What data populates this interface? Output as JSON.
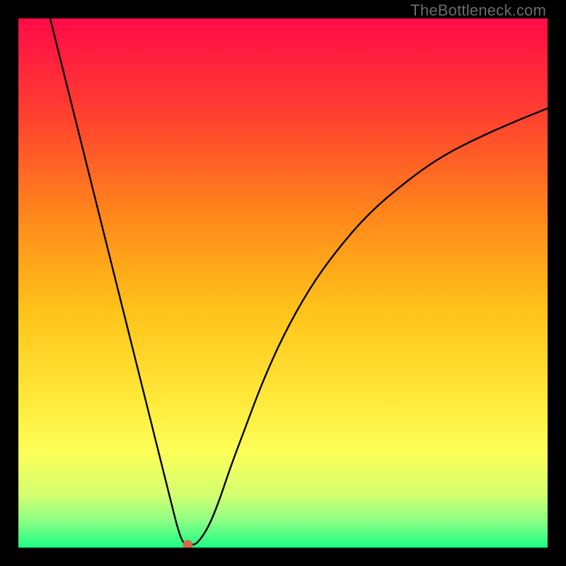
{
  "watermark": "TheBottleneck.com",
  "chart_data": {
    "type": "line",
    "title": "",
    "xlabel": "",
    "ylabel": "",
    "xlim": [
      0,
      100
    ],
    "ylim": [
      0,
      100
    ],
    "grid": false,
    "legend": false,
    "gradient_stops": [
      {
        "offset": 0.0,
        "color": "#ff0b47"
      },
      {
        "offset": 0.18,
        "color": "#ff3f30"
      },
      {
        "offset": 0.38,
        "color": "#ff8a1a"
      },
      {
        "offset": 0.55,
        "color": "#ffc21a"
      },
      {
        "offset": 0.72,
        "color": "#ffe93a"
      },
      {
        "offset": 0.82,
        "color": "#fcff58"
      },
      {
        "offset": 0.9,
        "color": "#d4ff70"
      },
      {
        "offset": 0.95,
        "color": "#8aff84"
      },
      {
        "offset": 1.0,
        "color": "#1bff86"
      }
    ],
    "series": [
      {
        "name": "bottleneck-curve",
        "x": [
          6,
          8,
          10,
          12,
          14,
          16,
          18,
          20,
          22,
          24,
          26,
          28,
          29,
          30,
          31,
          32,
          33,
          34,
          36,
          38,
          40,
          43,
          46,
          50,
          55,
          60,
          66,
          73,
          80,
          88,
          95,
          100
        ],
        "y": [
          100,
          92,
          84,
          76,
          68,
          60,
          52,
          44,
          36,
          28,
          20,
          12,
          8,
          4,
          1,
          0.5,
          0.5,
          1,
          4,
          9,
          15,
          23,
          31,
          40,
          49,
          56,
          63,
          69,
          74,
          78,
          81,
          83
        ]
      }
    ],
    "marker": {
      "x": 32,
      "y": 0.5,
      "color": "#d46a4a",
      "radius_px": 7
    }
  }
}
